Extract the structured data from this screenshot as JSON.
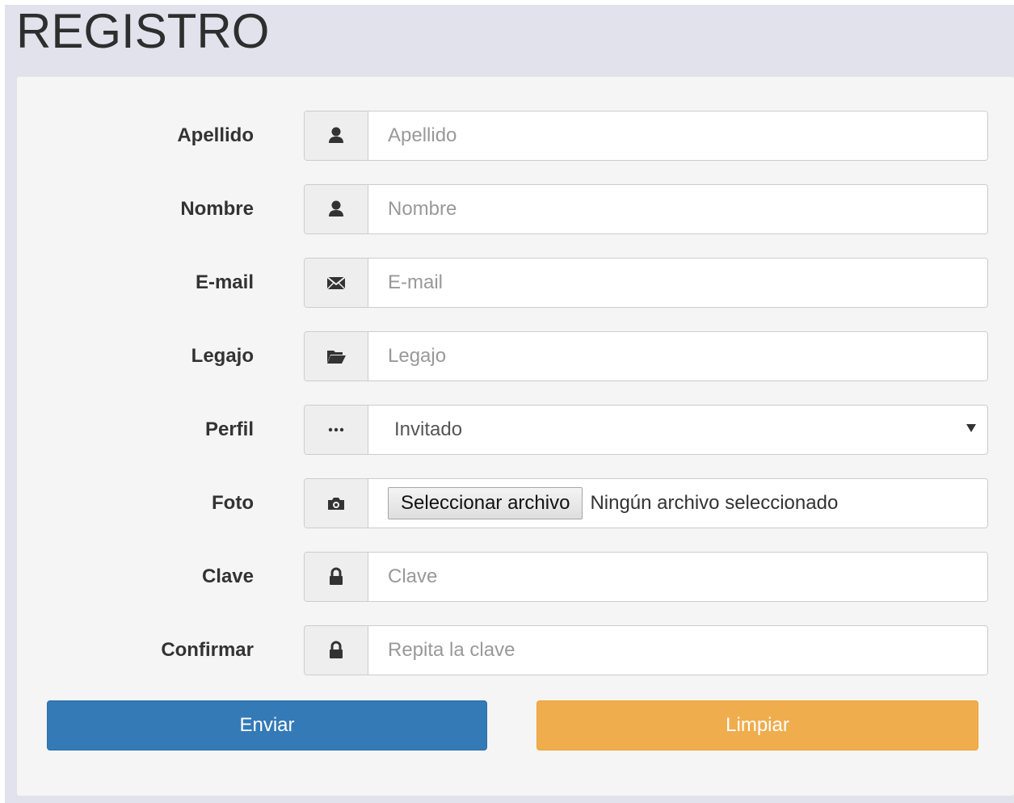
{
  "title": "REGISTRO",
  "fields": [
    {
      "label": "Apellido",
      "placeholder": "Apellido",
      "icon": "user-icon"
    },
    {
      "label": "Nombre",
      "placeholder": "Nombre",
      "icon": "user-icon"
    },
    {
      "label": "E-mail",
      "placeholder": "E-mail",
      "icon": "envelope-icon"
    },
    {
      "label": "Legajo",
      "placeholder": "Legajo",
      "icon": "folder-open-icon"
    }
  ],
  "perfil": {
    "label": "Perfil",
    "value": "Invitado",
    "icon": "ellipsis-icon"
  },
  "foto": {
    "label": "Foto",
    "button": "Seleccionar archivo",
    "status": "Ningún archivo seleccionado",
    "icon": "camera-icon"
  },
  "clave": {
    "label": "Clave",
    "placeholder": "Clave",
    "icon": "lock-icon"
  },
  "confirmar": {
    "label": "Confirmar",
    "placeholder": "Repita la clave",
    "icon": "lock-icon"
  },
  "buttons": {
    "send": "Enviar",
    "clear": "Limpiar"
  },
  "colors": {
    "primary": "#337ab7",
    "warning": "#f0ad4e",
    "page_bg": "#e1e2ec",
    "panel_bg": "#f5f5f5"
  }
}
